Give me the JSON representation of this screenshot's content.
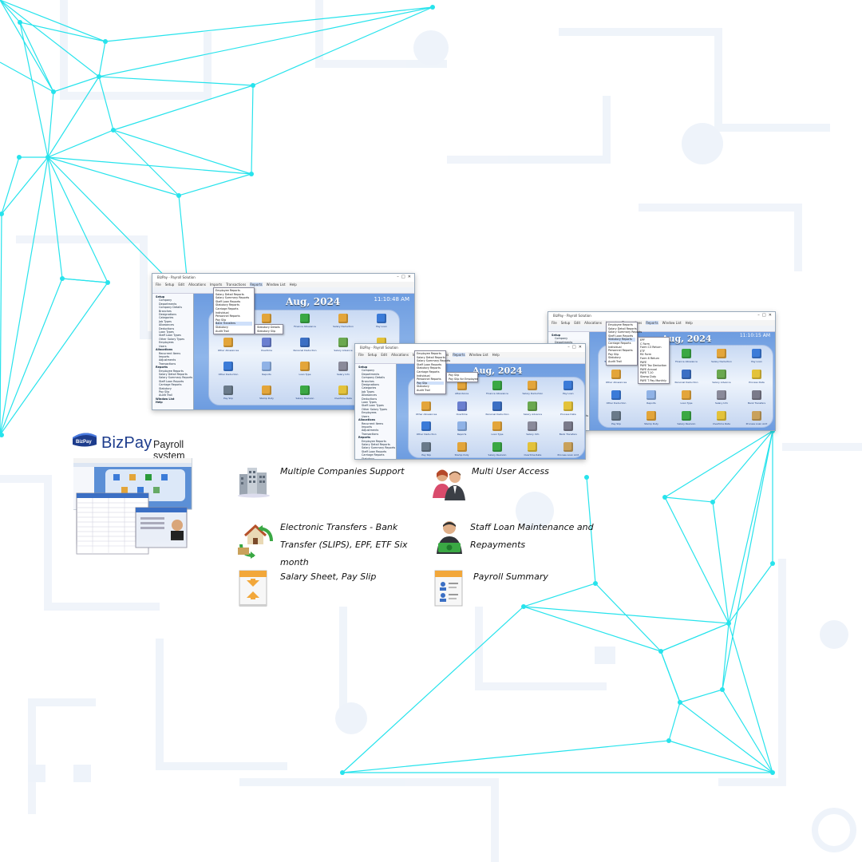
{
  "brand": {
    "name": "BizPay",
    "badge_text": "BizPay",
    "tagline": "Payroll system",
    "colors": {
      "brand_blue": "#1d3c8c",
      "accent_cyan": "#27e3ec",
      "app_blue": "#6f9fe0"
    }
  },
  "features": [
    {
      "label": "Multiple Companies Support",
      "icon": "buildings-icon"
    },
    {
      "label": "Multi User Access",
      "icon": "users-icon"
    },
    {
      "label": "Electronic Transfers - Bank Transfer (SLIPS), EPF, ETF Six month",
      "icon": "transfer-house-icon"
    },
    {
      "label": "Staff Loan Maintenance and Repayments",
      "icon": "loan-icon"
    },
    {
      "label": "Salary Sheet, Pay Slip",
      "icon": "salary-sheet-icon"
    },
    {
      "label": "Payroll Summary",
      "icon": "summary-report-icon"
    }
  ],
  "screenshots": {
    "app_title": "BizPay - Payroll Solution",
    "menu": [
      "File",
      "Setup",
      "Edit",
      "Allocations",
      "Imports",
      "Transactions",
      "Reports",
      "Window List",
      "Help"
    ],
    "period": "Aug, 2024",
    "shot1": {
      "time": "11:10:48 AM",
      "menu_items": [
        "Employee Reports",
        "Salary Detail Reports",
        "Salary Summary Reports",
        "Staff Loan Reports",
        "Statutory Reports",
        "Carriage Reports",
        "Individual",
        "Personnel Reports",
        "Pay Slip",
        "Bank Transfers",
        "Statutory",
        "Audit Trail"
      ],
      "submenu": [
        "Statutory Details",
        "Statutory Slip"
      ]
    },
    "shot2": {
      "menu_items": [
        "Employee Reports",
        "Salary Detail Reports",
        "Salary Summary Reports",
        "Staff Loan Reports",
        "Statutory Reports",
        "Carriage Reports",
        "Individual",
        "Personnel Reports",
        "Pay Slip",
        "Statutory",
        "Audit Trail"
      ],
      "submenu": [
        "Pay Slip",
        "Pay Slip for Employee"
      ]
    },
    "shot3": {
      "time": "11:10:15 AM",
      "menu_items": [
        "Employee Reports",
        "Salary Detail Reports",
        "Salary Summary Reports",
        "Staff Loan Reports",
        "Statutory Reports",
        "Carriage Reports",
        "Individual",
        "Personnel Reports",
        "Pay Slip",
        "Statutory",
        "Audit Trail"
      ],
      "submenu": [
        "EPF",
        "C Form",
        "Form C3 Return",
        "ETF",
        "R4 Form",
        "Form 6 Return",
        "PAYE",
        "PAYE Tax Deduction",
        "PAYE Annual",
        "PAYE T-10",
        "Stamp Duty",
        "PAYE T Pay Monthly"
      ]
    },
    "sidebar_items": [
      "Setup",
      "Company",
      "Departments",
      "Company Details",
      "Branches",
      "Designations",
      "Categories",
      "Job Types",
      "Allowances",
      "Deductions",
      "Loan Types",
      "Staff Loan Types",
      "Other Salary Types",
      "Employees",
      "Users",
      "Allocations",
      "Recurrent Items",
      "Imports",
      "Adjustments",
      "Transactions",
      "Reports",
      "Employee Reports",
      "Salary Detail Reports",
      "Salary Summary Reports",
      "Staff Loan Reports",
      "Carriage Reports",
      "Statutory",
      "Pay Slip",
      "Audit Trail",
      "Window List",
      "Help"
    ],
    "icon_labels": [
      "Transfer Allowances",
      "Attendance",
      "Finance Allowance",
      "Salary Deduction",
      "Pay Loan",
      "Other Allowances",
      "Overtime",
      "Personal Deduction",
      "Salary Advance",
      "Process Data",
      "Other Deduction",
      "Reports",
      "Loan Type",
      "Salary Info",
      "Bank Transfers",
      "Pay Slip",
      "Stamp Duty",
      "Salary Revision",
      "Overtime Rate",
      "Process Loan Amt"
    ]
  }
}
